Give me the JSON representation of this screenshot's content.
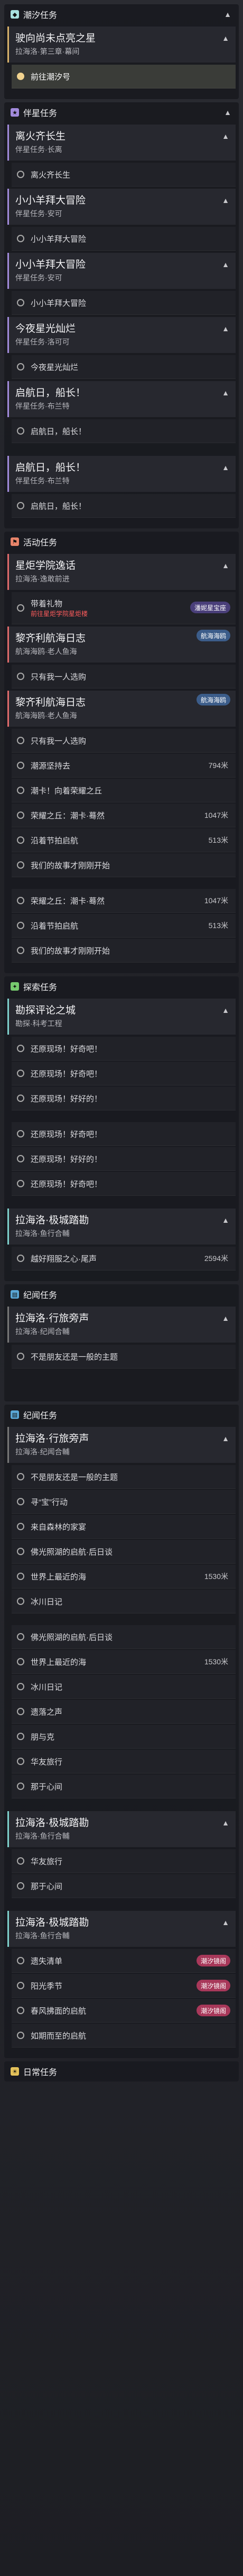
{
  "sections": {
    "tidal": {
      "label": "潮汐任务"
    },
    "companion": {
      "label": "伴星任务"
    },
    "event": {
      "label": "活动任务"
    },
    "exploration": {
      "label": "探索任务"
    },
    "region": {
      "label": "纪闻任务"
    },
    "daily": {
      "label": "日常任务"
    }
  },
  "quests": {
    "q1": {
      "title": "驶向尚未点亮之星",
      "sub": "拉海洛·第三章·幕间"
    },
    "q2": {
      "title": "离火齐长生",
      "sub": "伴星任务·长离"
    },
    "q3": {
      "title": "小小羊拜大冒险",
      "sub": "伴星任务·安可"
    },
    "q4": {
      "title": "小小羊拜大冒险",
      "sub": "伴星任务·安可"
    },
    "q5": {
      "title": "今夜星光灿烂",
      "sub": "伴星任务·洛可可"
    },
    "q6": {
      "title": "启航日，船长！",
      "sub": "伴星任务·布兰特"
    },
    "q7": {
      "title": "启航日，船长！",
      "sub": "伴星任务·布兰特"
    },
    "q8": {
      "title": "星炬学院逸话",
      "sub": "拉海洛·逸敢前进"
    },
    "q9": {
      "title": "黎齐利航海日志",
      "sub": "航海海鸥·老人鱼海"
    },
    "q10": {
      "title": "黎齐利航海日志",
      "sub": "航海海鸥·老人鱼海"
    },
    "q11": {
      "title": "勘探评论之城",
      "sub": "勘探·科考工程"
    },
    "q12": {
      "title": "拉海洛·极城踏勘",
      "sub": "拉海洛·鱼行合輔"
    },
    "q13": {
      "title": "拉海洛·行旅旁声",
      "sub": "拉海洛·纪闻合輔"
    },
    "q14": {
      "title": "拉海洛·行旅旁声",
      "sub": "拉海洛·纪闻合輔"
    },
    "q15": {
      "title": "拉海洛·极城踏勘",
      "sub": "拉海洛·鱼行合輔"
    },
    "q16": {
      "title": "拉海洛·极城踏勘",
      "sub": "拉海洛·鱼行合輔"
    }
  },
  "steps": {
    "s1": "前往潮汐号",
    "s2": "离火齐长生",
    "s3": "小小羊拜大冒险",
    "s4": "小小羊拜大冒险",
    "s5": "今夜星光灿烂",
    "s6": "启航日，船长！",
    "s7": "启航日，船长！",
    "s8": "带着礼物",
    "s8_red": "前往星炬学院星炬楼",
    "s9": "只有我一人选购",
    "s10": "只有我一人选购",
    "s11": "潮源坚持去",
    "s12": "潮卡！向着荣耀之丘",
    "s13": "荣耀之丘：潮卡·蓦然",
    "s14": "沿着节拍启航",
    "s15": "我们的故事才刚刚开始",
    "s16": "荣耀之丘：潮卡·蓦然",
    "s17": "沿着节拍启航",
    "s18": "我们的故事才刚刚开始",
    "s19": "还原现场！好奇吧！",
    "s20": "还原现场！好奇吧！",
    "s21": "还原现场！好好的！",
    "s22": "还原现场！好奇吧！",
    "s23": "还原现场！好好的！",
    "s24": "还原现场！好奇吧！",
    "s25": "越好翔服之心·尾声",
    "s26": "不是朋友还是一般的主题",
    "s27": "不是朋友还是一般的主题",
    "s28": "寻“宝”行动",
    "s29": "来自森林的家宴",
    "s30": "佛光照湖的启航·后日谈",
    "s31": "世界上最近的海",
    "s32": "冰川日记",
    "s33": "佛光照湖的启航·后日谈",
    "s34": "世界上最近的海",
    "s35": "冰川日记",
    "s36": "遗落之声",
    "s37": "朋与克",
    "s38": "华友旅行",
    "s39": "那于心间",
    "s40": "华友旅行",
    "s41": "那于心间",
    "s42": "遗失清单",
    "s43": "阳光季节",
    "s44": "春风拂面的启航",
    "s45": "如期而至的启航"
  },
  "dists": {
    "d11": "794米",
    "d13": "1047米",
    "d14": "513米",
    "d16": "1047米",
    "d17": "513米",
    "d25": "2594米",
    "d31": "1530米",
    "d34": "1530米"
  },
  "badges": {
    "b1": "潘妮星宝座",
    "b2": "航海海鸥",
    "b3": "航海海鸥",
    "b4": "潮汐镜阁",
    "b5": "潮汐镜阁",
    "b6": "潮汐镜阁"
  },
  "colors": {
    "tidal": "#a8e1e0",
    "companion": "#a28bdc",
    "event": "#e8846a",
    "exploration": "#76c96e",
    "region": "#5aa7d6",
    "daily": "#e4c15a"
  }
}
